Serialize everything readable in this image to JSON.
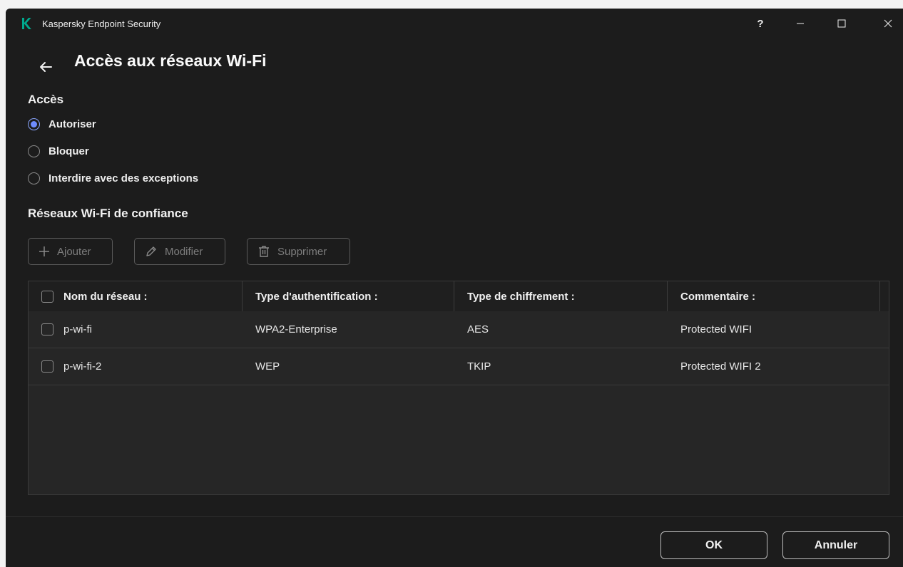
{
  "window": {
    "title": "Kaspersky Endpoint Security",
    "controls": {
      "help": "?",
      "minimize": "—",
      "maximize": "☐",
      "close": "✕"
    }
  },
  "page": {
    "title": "Accès aux réseaux Wi-Fi"
  },
  "access": {
    "heading": "Accès",
    "options": [
      {
        "label": "Autoriser",
        "selected": true
      },
      {
        "label": "Bloquer",
        "selected": false
      },
      {
        "label": "Interdire avec des exceptions",
        "selected": false
      }
    ]
  },
  "trusted": {
    "heading": "Réseaux Wi-Fi de confiance",
    "toolbar": {
      "add": "Ajouter",
      "edit": "Modifier",
      "delete": "Supprimer"
    },
    "columns": [
      "Nom du réseau :",
      "Type d'authentification :",
      "Type de chiffrement :",
      "Commentaire :"
    ],
    "rows": [
      {
        "name": "p-wi-fi",
        "auth": "WPA2-Enterprise",
        "encryption": "AES",
        "comment": "Protected WIFI"
      },
      {
        "name": "p-wi-fi-2",
        "auth": "WEP",
        "encryption": "TKIP",
        "comment": "Protected WIFI 2"
      }
    ]
  },
  "footer": {
    "ok": "OK",
    "cancel": "Annuler"
  },
  "colors": {
    "accent": "#6e8cff",
    "brand": "#00a88e",
    "background": "#1c1c1c"
  },
  "icons": [
    "kaspersky-logo-icon",
    "back-arrow-icon",
    "plus-icon",
    "pencil-icon",
    "trash-icon"
  ]
}
